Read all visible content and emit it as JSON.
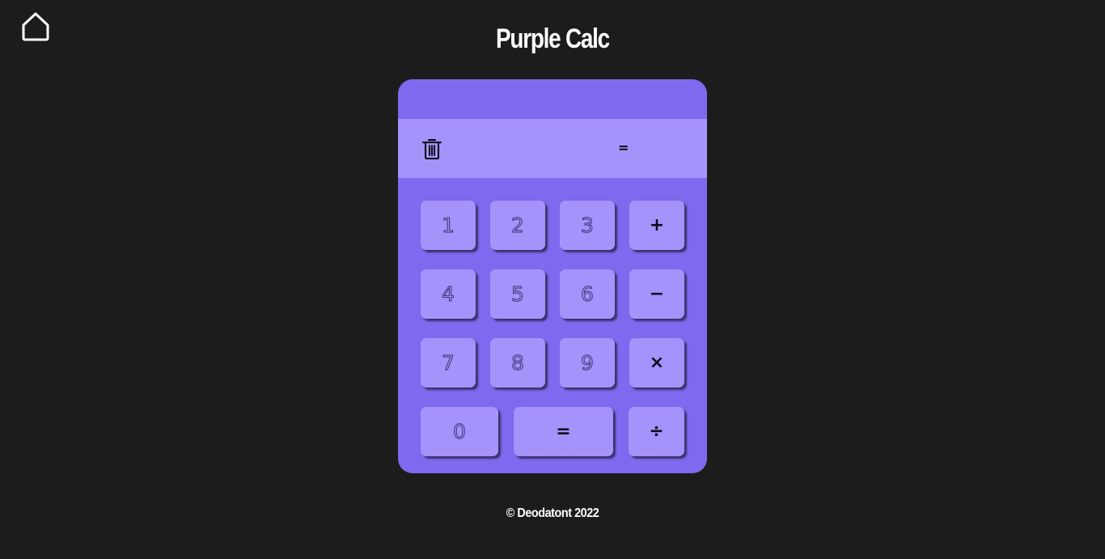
{
  "page": {
    "title": "Purple Calc",
    "footer": "© Deodatont 2022"
  },
  "display": {
    "expression": "",
    "result": "="
  },
  "keys": {
    "k1": "1",
    "k2": "2",
    "k3": "3",
    "plus": "+",
    "k4": "4",
    "k5": "5",
    "k6": "6",
    "minus": "−",
    "k7": "7",
    "k8": "8",
    "k9": "9",
    "times": "×",
    "k0": "0",
    "equals": "=",
    "divide": "÷"
  },
  "icons": {
    "home": "home-icon",
    "clear": "trash-icon"
  },
  "colors": {
    "background": "#1c1c1c",
    "calculator": "#7f69ee",
    "display": "#a593fb",
    "key": "#a593fb"
  }
}
